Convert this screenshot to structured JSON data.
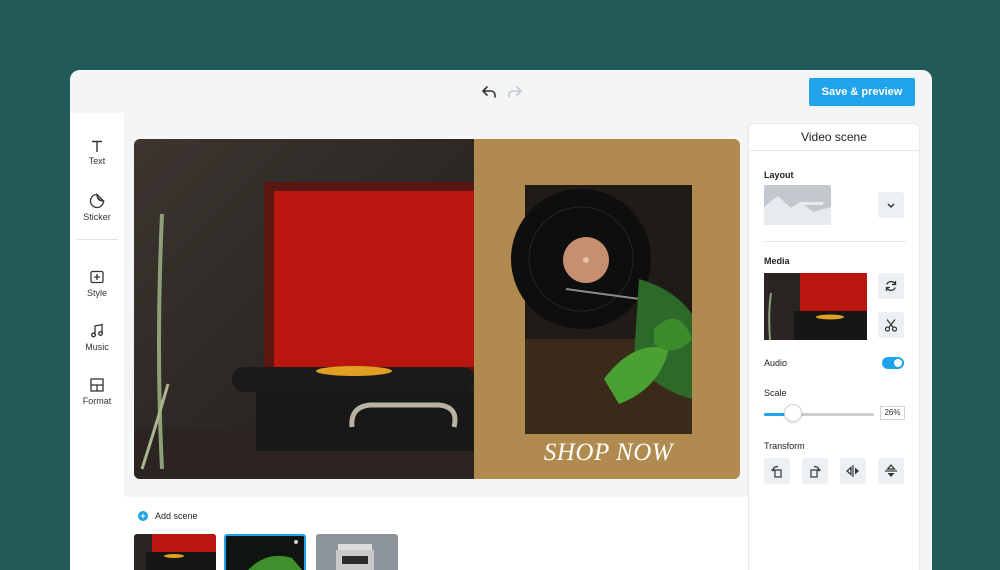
{
  "toolbar": {
    "save_label": "Save & preview"
  },
  "tools": [
    {
      "label": "Text",
      "icon": "text-icon"
    },
    {
      "label": "Sticker",
      "icon": "sticker-icon"
    },
    {
      "label": "Style",
      "icon": "style-icon"
    },
    {
      "label": "Music",
      "icon": "music-icon"
    },
    {
      "label": "Format",
      "icon": "format-icon"
    }
  ],
  "stage": {
    "headline": "SHOP NOW",
    "accent_color": "#b08a4e"
  },
  "scenes": {
    "add_label": "Add scene"
  },
  "panel": {
    "title": "Video scene",
    "layout_label": "Layout",
    "media_label": "Media",
    "audio_label": "Audio",
    "audio_on": true,
    "scale_label": "Scale",
    "scale_value": "26%",
    "scale_fraction": 0.26,
    "transform_label": "Transform"
  },
  "colors": {
    "accent": "#1fa3ea",
    "background": "#225a58"
  }
}
